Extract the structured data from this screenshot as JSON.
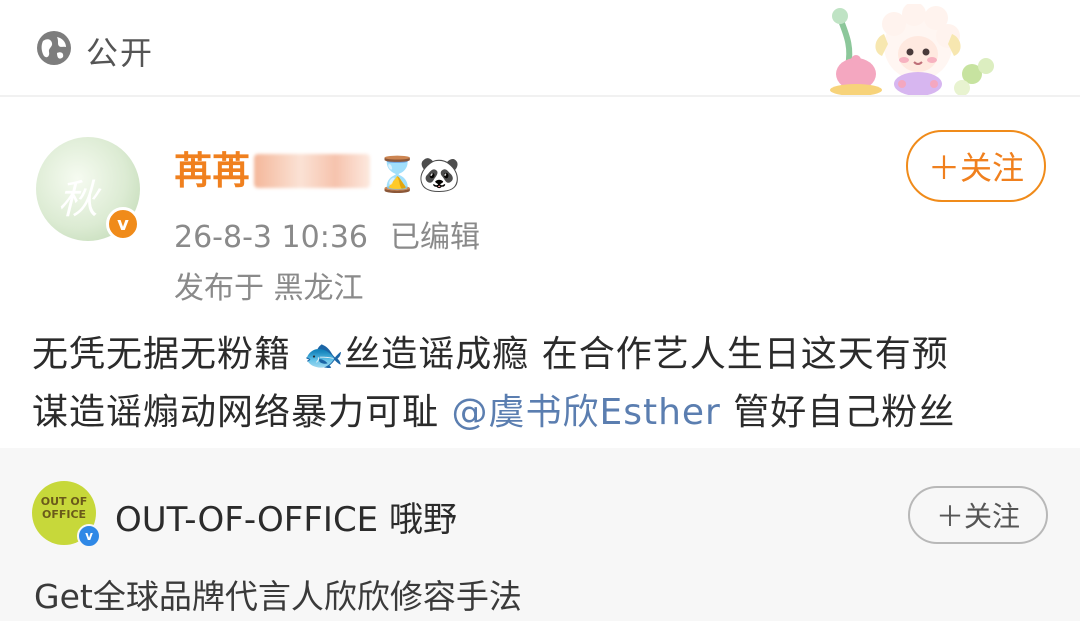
{
  "topbar": {
    "visibility_label": "公开",
    "icon": "globe-icon",
    "sticker": "sheep-sticker"
  },
  "post": {
    "author_name_visible": "苒苒",
    "author_name_obscured": true,
    "author_emojis": "⌛🐼",
    "timestamp": "26-8-3 10:36",
    "edited_label": "已编辑",
    "location_label": "发布于 黑龙江",
    "follow_label": "＋关注",
    "verified_badge": "orange",
    "accent_color": "#f0801e",
    "text_line1_a": "无凭无据无粉籍 ",
    "text_fish": "🐟",
    "text_line1_b": "丝造谣成瘾 在合作艺人生日这天有预",
    "text_line2_a": "谋造谣煽动网络暴力可耻 ",
    "mention": "@虞书欣Esther",
    "text_line2_b": " 管好自己粉丝",
    "mention_color": "#5b7eb0"
  },
  "card": {
    "avatar_text": "OUT OF OFFICE",
    "verified_badge": "blue",
    "name": "OUT-OF-OFFICE 哦野",
    "follow_label": "＋关注",
    "text": "Get全球品牌代言人欣欣修容手法"
  }
}
